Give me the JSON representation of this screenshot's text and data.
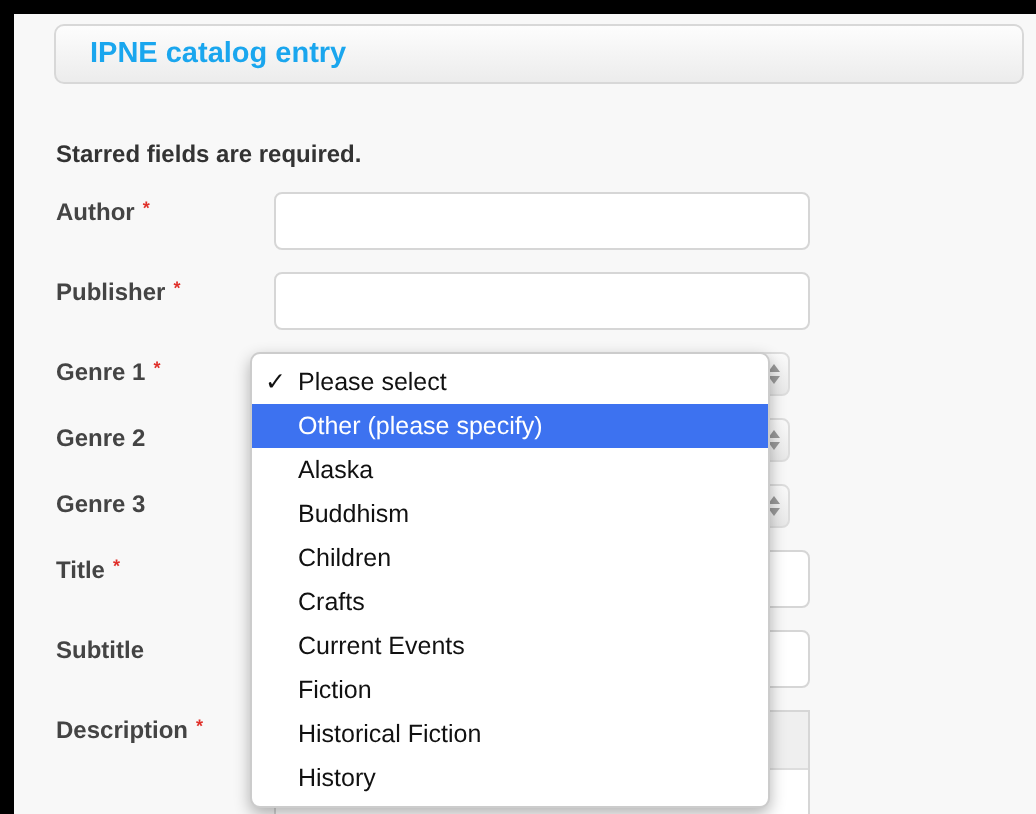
{
  "header": {
    "title": "IPNE catalog entry"
  },
  "note": "Starred fields are required.",
  "fields": [
    {
      "label": "Author",
      "required": true,
      "kind": "text"
    },
    {
      "label": "Publisher",
      "required": true,
      "kind": "text"
    },
    {
      "label": "Genre 1",
      "required": true,
      "kind": "select"
    },
    {
      "label": "Genre 2",
      "required": false,
      "kind": "select"
    },
    {
      "label": "Genre 3",
      "required": false,
      "kind": "select"
    },
    {
      "label": "Title",
      "required": true,
      "kind": "text"
    },
    {
      "label": "Subtitle",
      "required": false,
      "kind": "text"
    },
    {
      "label": "Description",
      "required": true,
      "kind": "richtext"
    }
  ],
  "required_mark": "*",
  "dropdown": {
    "check_mark": "✓",
    "options": [
      {
        "label": "Please select",
        "checked": true,
        "selected": false
      },
      {
        "label": "Other (please specify)",
        "checked": false,
        "selected": true
      },
      {
        "label": "Alaska",
        "checked": false,
        "selected": false
      },
      {
        "label": "Buddhism",
        "checked": false,
        "selected": false
      },
      {
        "label": "Children",
        "checked": false,
        "selected": false
      },
      {
        "label": "Crafts",
        "checked": false,
        "selected": false
      },
      {
        "label": "Current Events",
        "checked": false,
        "selected": false
      },
      {
        "label": "Fiction",
        "checked": false,
        "selected": false
      },
      {
        "label": "Historical Fiction",
        "checked": false,
        "selected": false
      },
      {
        "label": "History",
        "checked": false,
        "selected": false
      }
    ]
  }
}
